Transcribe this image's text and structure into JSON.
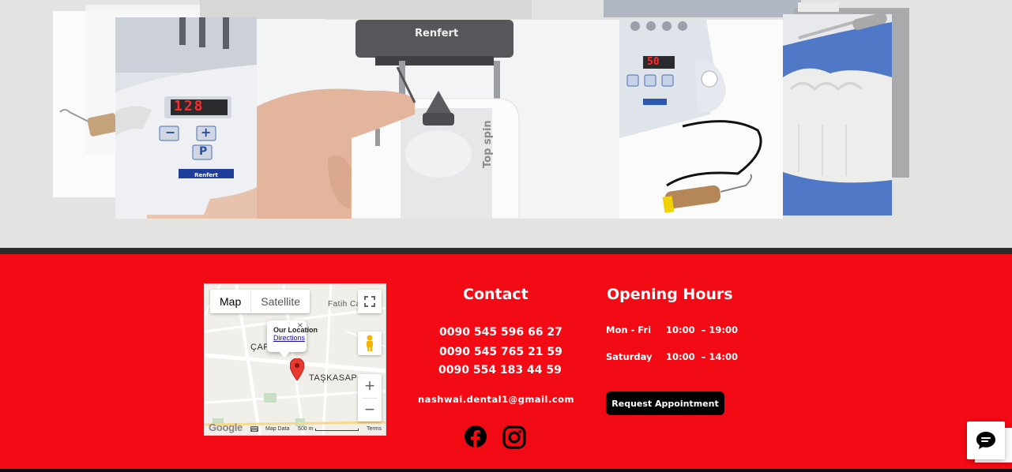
{
  "gallery": {
    "brand_text": "Renfert",
    "display_left": "128",
    "display_right": "50",
    "device_text": "Top spin"
  },
  "map": {
    "type_map": "Map",
    "type_satellite": "Satellite",
    "popup_title": "Our Location",
    "popup_link": "Directions",
    "label_fatih": "Fatih Ca",
    "label_car": "ÇAR",
    "label_taskasap": "TAŞKASAP",
    "footer_data": "Map Data",
    "footer_scale": "500 m",
    "footer_terms": "Terms",
    "google_logo": "Google"
  },
  "contact": {
    "title": "Contact",
    "phones": [
      "0090 545 596 66 27",
      "0090 545 765 21 59",
      "0090 554 183 44 59"
    ],
    "email": "nashwai.dental1@gmail.com"
  },
  "hours": {
    "title": "Opening Hours",
    "rows": [
      {
        "day": "Mon - Fri",
        "time": "10:00  – 19:00"
      },
      {
        "day": "Saturday",
        "time": "10:00  – 14:00"
      }
    ]
  },
  "cta": {
    "label": "Request Appointment"
  },
  "icons": {
    "facebook": "facebook-icon",
    "instagram": "instagram-icon",
    "chat": "chat-icon"
  },
  "colors": {
    "footer_bg": "#f20a14",
    "gallery_bg": "#e3e4e2",
    "button_bg": "#000000"
  }
}
